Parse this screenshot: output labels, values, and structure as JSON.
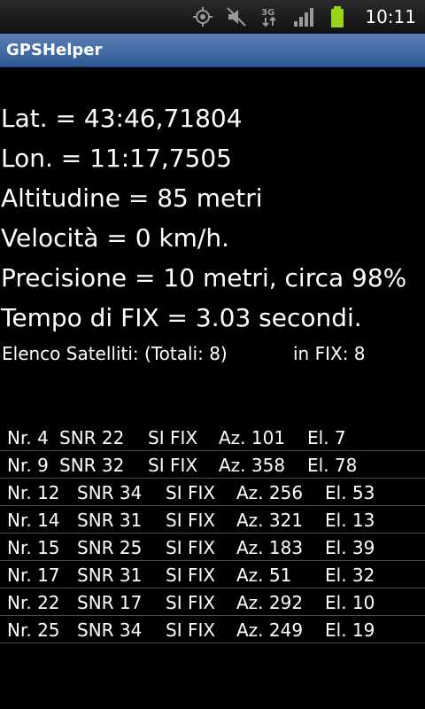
{
  "status_bar": {
    "time": "10:11",
    "icons": [
      "gps-icon",
      "mute-icon",
      "3g-data-icon",
      "signal-icon",
      "battery-icon"
    ],
    "data_label": "3G"
  },
  "app": {
    "title": "GPSHelper"
  },
  "info": {
    "lat": "Lat. = 43:46,71804",
    "lon": "Lon. = 11:17,7505",
    "altitude": "Altitudine = 85 metri",
    "speed": "Velocità = 0 km/h.",
    "precision": "Precisione = 10 metri, circa 98%",
    "fix_time": "Tempo di FIX = 3.03 secondi."
  },
  "satellites": {
    "summary_label": "Elenco Satelliti: (Totali: 8)",
    "in_fix_label": "in FIX: 8",
    "rows": [
      {
        "nr": "Nr. 4",
        "snr": "SNR 22",
        "fix": "SI FIX",
        "az": "Az. 101",
        "el": "El. 7"
      },
      {
        "nr": "Nr. 9",
        "snr": "SNR 32",
        "fix": "SI FIX",
        "az": "Az. 358",
        "el": "El. 78"
      },
      {
        "nr": "Nr. 12",
        "snr": "SNR 34",
        "fix": "SI FIX",
        "az": "Az. 256",
        "el": "El. 53"
      },
      {
        "nr": "Nr. 14",
        "snr": "SNR 31",
        "fix": "SI FIX",
        "az": "Az. 321",
        "el": "El. 13"
      },
      {
        "nr": "Nr. 15",
        "snr": "SNR 25",
        "fix": "SI FIX",
        "az": "Az. 183",
        "el": "El. 39"
      },
      {
        "nr": "Nr. 17",
        "snr": "SNR 31",
        "fix": "SI FIX",
        "az": "Az. 51",
        "el": "El. 32"
      },
      {
        "nr": "Nr. 22",
        "snr": "SNR 17",
        "fix": "SI FIX",
        "az": "Az. 292",
        "el": "El. 10"
      },
      {
        "nr": "Nr. 25",
        "snr": "SNR 34",
        "fix": "SI FIX",
        "az": "Az. 249",
        "el": "El. 19"
      }
    ]
  },
  "colors": {
    "background": "#000000",
    "title_bar": "#3f6aa6",
    "battery": "#9bd21a"
  }
}
